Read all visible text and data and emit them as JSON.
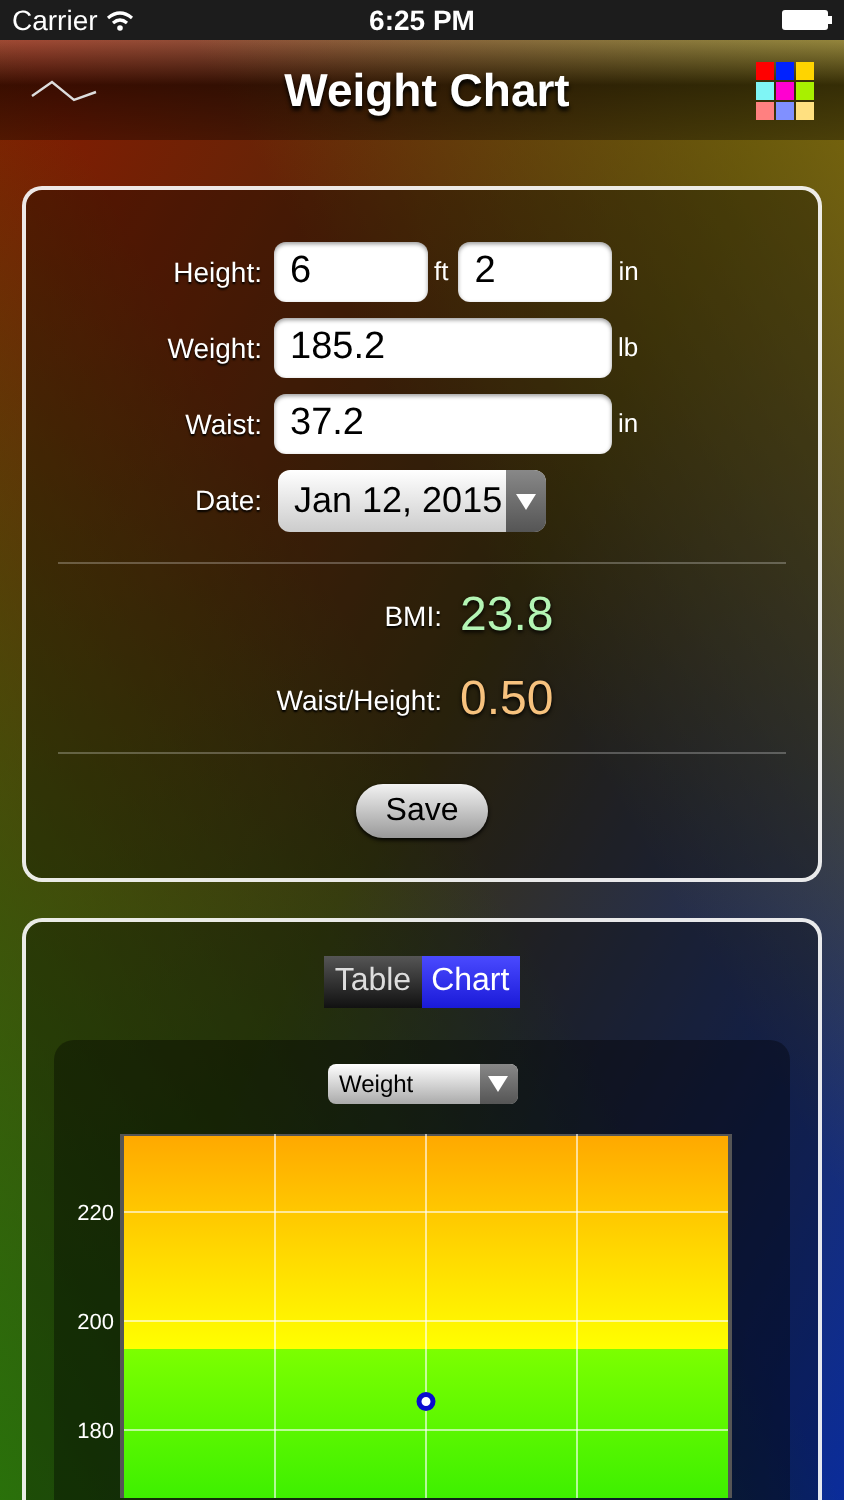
{
  "status_bar": {
    "carrier": "Carrier",
    "time": "6:25 PM"
  },
  "nav": {
    "title": "Weight Chart"
  },
  "form": {
    "height": {
      "label": "Height:",
      "feet": "6",
      "feet_unit": "ft",
      "inches": "2",
      "inches_unit": "in"
    },
    "weight": {
      "label": "Weight:",
      "value": "185.2",
      "unit": "lb"
    },
    "waist": {
      "label": "Waist:",
      "value": "37.2",
      "unit": "in"
    },
    "date": {
      "label": "Date:",
      "value": "Jan 12, 2015"
    }
  },
  "results": [
    {
      "label": "BMI:",
      "value": "23.8",
      "color": "#b4f5b4"
    },
    {
      "label": "Waist/Height:",
      "value": "0.50",
      "color": "#f7c27e"
    }
  ],
  "save_button": "Save",
  "tabs": [
    {
      "label": "Table",
      "selected": false
    },
    {
      "label": "Chart",
      "selected": true
    }
  ],
  "metric_select": {
    "value": "Weight"
  },
  "chart_data": {
    "type": "scatter",
    "categories": [
      null
    ],
    "ylim": [
      167.5,
      234.3
    ],
    "yticks": [
      180,
      200,
      220
    ],
    "grid": true,
    "series": [
      {
        "color": "#0a0ad0",
        "values": [
          185.2
        ]
      }
    ]
  }
}
